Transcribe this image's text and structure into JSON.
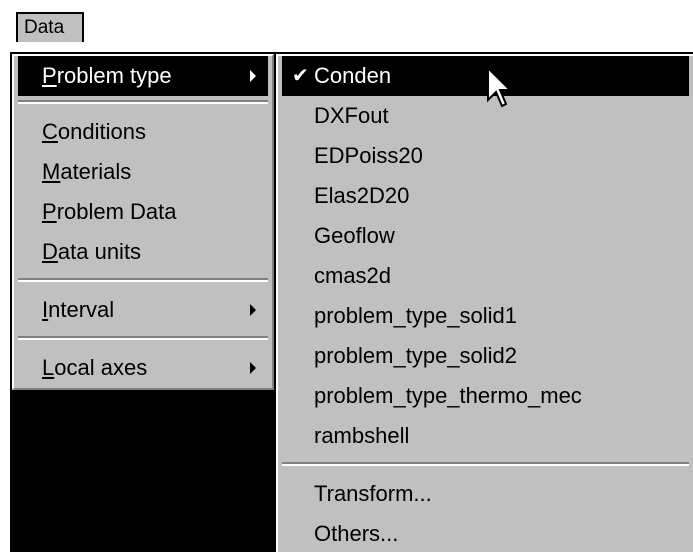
{
  "menubar": {
    "data_label": "Data"
  },
  "data_menu": {
    "items": [
      {
        "label": "Problem type",
        "ul": "P",
        "rest": "roblem type"
      },
      {
        "label": "Conditions",
        "ul": "C",
        "rest": "onditions"
      },
      {
        "label": "Materials",
        "ul": "M",
        "rest": "aterials"
      },
      {
        "label": "Problem Data",
        "ul": "P",
        "rest": "roblem Data"
      },
      {
        "label": "Data units",
        "ul": "D",
        "rest": "ata units"
      },
      {
        "label": "Interval",
        "ul": "I",
        "rest": "nterval"
      },
      {
        "label": "Local axes",
        "ul": "L",
        "rest": "ocal axes"
      }
    ]
  },
  "problem_type_menu": {
    "items": [
      "Conden",
      "DXFout",
      "EDPoiss20",
      "Elas2D20",
      "Geoflow",
      "cmas2d",
      "problem_type_solid1",
      "problem_type_solid2",
      "problem_type_thermo_mec",
      "rambshell",
      "Transform...",
      "Others..."
    ],
    "checked_item": "Conden"
  },
  "icons": {
    "check": "checkmark-icon",
    "submenu_arrow": "submenu-arrow-icon",
    "cursor": "mouse-pointer-icon"
  },
  "colors": {
    "menu_bg": "#c0c0c0",
    "highlight_bg": "#000000",
    "highlight_fg": "#ffffff"
  }
}
